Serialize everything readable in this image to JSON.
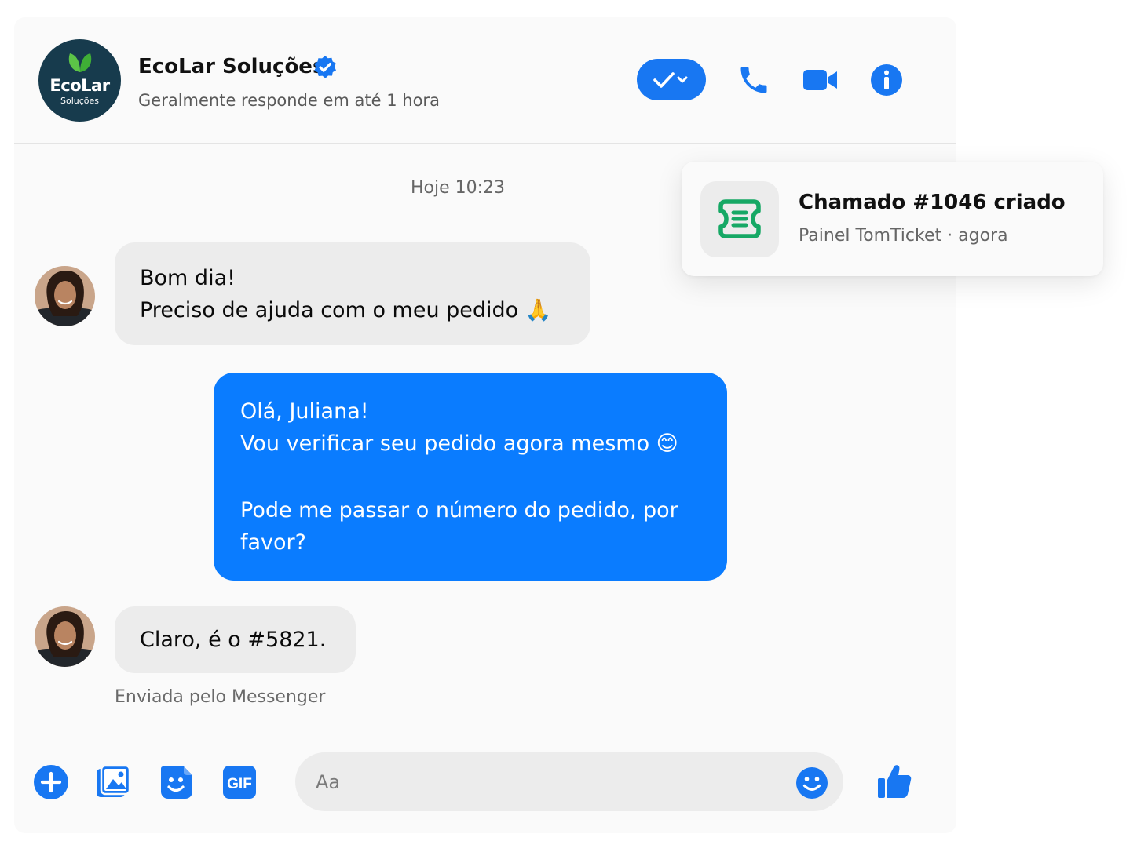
{
  "header": {
    "logo": {
      "main": "EcoLar",
      "sub": "Soluções"
    },
    "company_name": "EcoLar Soluções",
    "response_status": "Geralmente responde em até 1 hora",
    "actions": [
      "check-status-menu",
      "phone-call",
      "video-call",
      "info"
    ]
  },
  "conversation": {
    "timestamp": "Hoje 10:23",
    "messages": [
      {
        "direction": "incoming",
        "lines": [
          "Bom dia!",
          "Preciso de ajuda com o meu pedido 🙏"
        ]
      },
      {
        "direction": "outgoing",
        "lines": [
          "Olá, Juliana!",
          "Vou verificar seu pedido agora mesmo 😊",
          "",
          "Pode me passar o número do pedido, por",
          "favor?"
        ]
      },
      {
        "direction": "incoming",
        "lines": [
          "Claro, é o #5821."
        ]
      }
    ],
    "delivery_note": "Enviada pelo Messenger"
  },
  "composer": {
    "placeholder": "Aa",
    "actions": [
      "plus-icon",
      "gallery-icon",
      "sticker-icon",
      "gif-icon"
    ],
    "gif_label": "GIF"
  },
  "notification": {
    "title": "Chamado #1046 criado",
    "source": "Painel TomTicket",
    "separator": "·",
    "time": "agora"
  },
  "colors": {
    "accent": "#1877f2",
    "outgoing_bubble": "#0a7cff",
    "incoming_bubble": "#ececec",
    "logo_background": "#173b4d",
    "ticket_icon": "#16a865"
  }
}
